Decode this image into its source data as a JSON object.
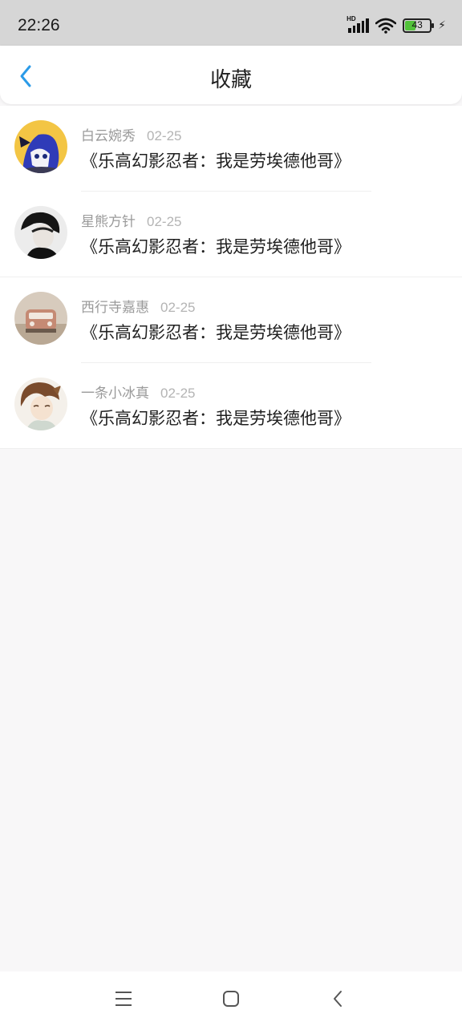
{
  "status_bar": {
    "time": "22:26",
    "network_label": "HD",
    "battery_level": "43",
    "battery_fraction": 0.43,
    "icons": [
      "signal-icon",
      "wifi-icon",
      "battery-icon",
      "charging-icon"
    ]
  },
  "header": {
    "title": "收藏",
    "accent_color": "#2b9be8"
  },
  "favorites": [
    {
      "author": "白云婉秀",
      "date": "02-25",
      "title": "《乐高幻影忍者：我是劳埃德他哥》"
    },
    {
      "author": "星熊方针",
      "date": "02-25",
      "title": "《乐高幻影忍者：我是劳埃德他哥》"
    },
    {
      "author": "西行寺嘉惠",
      "date": "02-25",
      "title": "《乐高幻影忍者：我是劳埃德他哥》"
    },
    {
      "author": "一条小冰真",
      "date": "02-25",
      "title": "《乐高幻影忍者：我是劳埃德他哥》"
    }
  ],
  "nav_bar": {
    "icons": [
      "menu-icon",
      "home-icon",
      "back-icon"
    ]
  }
}
